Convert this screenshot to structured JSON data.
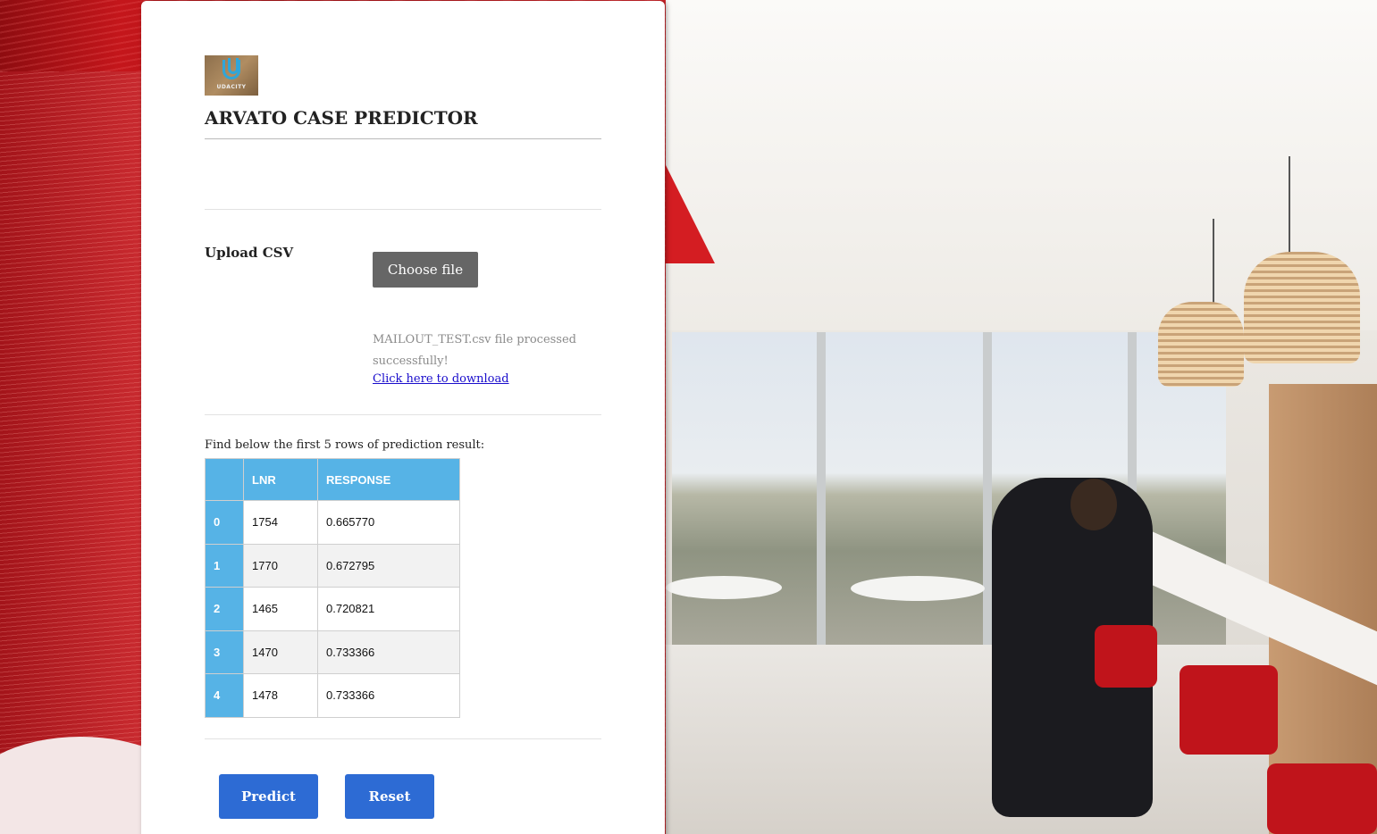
{
  "app": {
    "title": "ARVATO CASE PREDICTOR",
    "logo_text": "UDACITY"
  },
  "upload": {
    "label": "Upload CSV",
    "choose_button": "Choose file",
    "status_message": "MAILOUT_TEST.csv file processed successfully!",
    "download_link": "Click here to download"
  },
  "results": {
    "caption": "Find below the first 5 rows of prediction result:",
    "columns": [
      "",
      "LNR",
      "RESPONSE"
    ],
    "rows": [
      {
        "index": "0",
        "lnr": "1754",
        "response": "0.665770"
      },
      {
        "index": "1",
        "lnr": "1770",
        "response": "0.672795"
      },
      {
        "index": "2",
        "lnr": "1465",
        "response": "0.720821"
      },
      {
        "index": "3",
        "lnr": "1470",
        "response": "0.733366"
      },
      {
        "index": "4",
        "lnr": "1478",
        "response": "0.733366"
      }
    ]
  },
  "actions": {
    "predict_label": "Predict",
    "reset_label": "Reset"
  },
  "colors": {
    "table_header": "#56b3e6",
    "primary_button": "#2d6bd4",
    "file_button": "#666666",
    "link": "#1a0dcc"
  }
}
